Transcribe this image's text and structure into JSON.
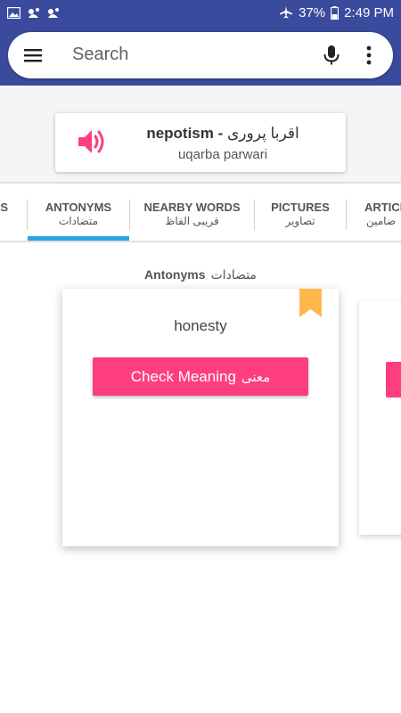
{
  "status_bar": {
    "battery": "37%",
    "time": "2:49 PM"
  },
  "search": {
    "placeholder": "Search"
  },
  "word": {
    "english": "nepotism",
    "separator": " - ",
    "urdu": "اقربا پروری",
    "roman": "uqarba parwari"
  },
  "tabs": [
    {
      "en": "S",
      "ur": ""
    },
    {
      "en": "ANTONYMS",
      "ur": "متضادات"
    },
    {
      "en": "NEARBY WORDS",
      "ur": "قریبی الفاظ"
    },
    {
      "en": "PICTURES",
      "ur": "تصاویر"
    },
    {
      "en": "ARTICL",
      "ur": "ضامین"
    }
  ],
  "active_tab": "ANTONYMS",
  "section": {
    "title_en": "Antonyms",
    "title_ur": "متضادات"
  },
  "cards": [
    {
      "word": "honesty",
      "button_en": "Check Meaning",
      "button_ur": "معنی"
    }
  ],
  "colors": {
    "primary": "#3a4a9c",
    "accent": "#ff3e7f",
    "tab_indicator": "#29a8e0",
    "bookmark": "#ffb74d"
  },
  "icons": {
    "menu": "menu-icon",
    "mic": "mic-icon",
    "more": "more-vert-icon",
    "speaker": "speaker-icon",
    "bookmark": "bookmark-icon"
  }
}
